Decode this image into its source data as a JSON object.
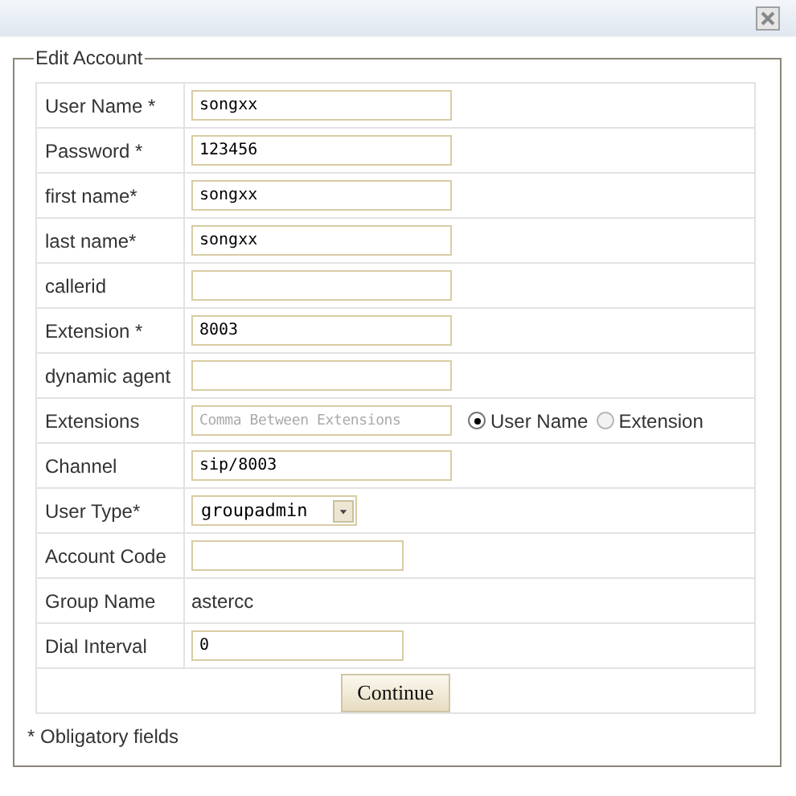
{
  "legend": "Edit Account",
  "rows": [
    {
      "kind": "text",
      "label": "User Name *",
      "value": "songxx"
    },
    {
      "kind": "text",
      "label": "Password *",
      "value": "123456"
    },
    {
      "kind": "text",
      "label": "first name*",
      "value": "songxx"
    },
    {
      "kind": "text",
      "label": "last name*",
      "value": "songxx"
    },
    {
      "kind": "text",
      "label": "callerid"
    },
    {
      "kind": "text",
      "label": "Extension *",
      "value": "8003"
    },
    {
      "kind": "text",
      "label": "dynamic agent"
    },
    {
      "kind": "extensions",
      "label": "Extensions",
      "placeholder": "Comma Between Extensions",
      "options": [
        {
          "label": "User Name",
          "selected": true
        },
        {
          "label": "Extension",
          "selected": false
        }
      ]
    },
    {
      "kind": "text",
      "label": "Channel",
      "value": "sip/8003"
    },
    {
      "kind": "select",
      "label": "User Type*",
      "value": "groupadmin"
    },
    {
      "kind": "short-text",
      "label": "Account Code"
    },
    {
      "kind": "static",
      "label": "Group Name",
      "value": "astercc"
    },
    {
      "kind": "short-text",
      "label": "Dial Interval",
      "value": "0"
    }
  ],
  "submit": "Continue",
  "footnote": "* Obligatory fields"
}
